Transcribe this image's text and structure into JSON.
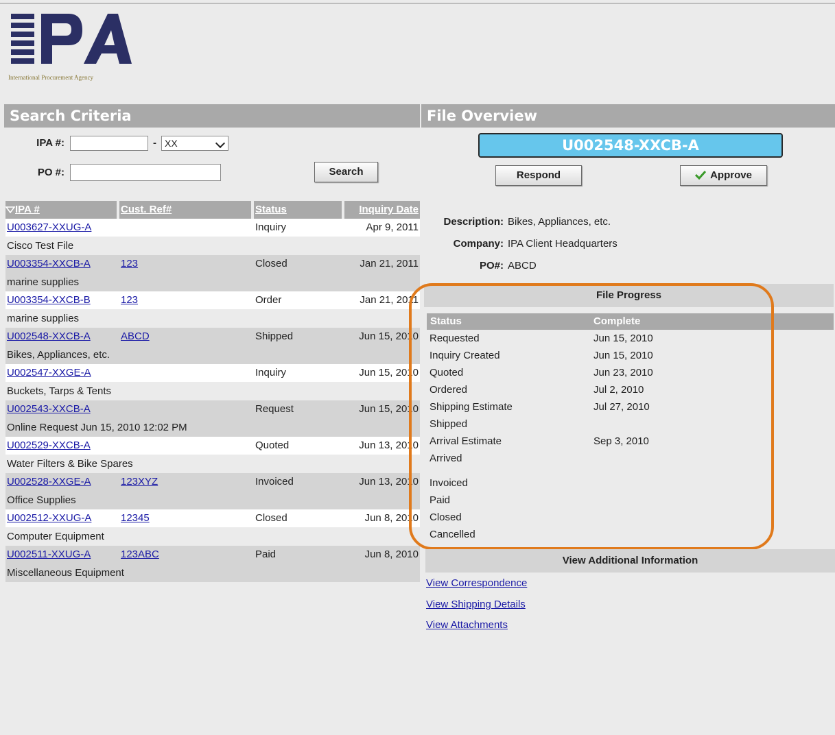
{
  "logo": {
    "letters": "IPA",
    "tagline": "International Procurement Agency"
  },
  "search": {
    "header": "Search Criteria",
    "ipa_label": "IPA #:",
    "ipa_value": "",
    "dash": "-",
    "suffix_select": "XX",
    "po_label": "PO #:",
    "po_value": "",
    "search_button": "Search"
  },
  "results": {
    "columns": [
      "IPA #",
      "Cust. Ref#",
      "Status",
      "Inquiry Date"
    ],
    "sort_icon": "sort-down-triangle-icon",
    "rows": [
      {
        "ipa": "U003627-XXUG-A",
        "ref": "",
        "status": "Inquiry",
        "date": "Apr 9, 2011",
        "desc": "Cisco Test File"
      },
      {
        "ipa": "U003354-XXCB-A",
        "ref": "123",
        "status": "Closed",
        "date": "Jan 21, 2011",
        "desc": "marine supplies"
      },
      {
        "ipa": "U003354-XXCB-B",
        "ref": "123",
        "status": "Order",
        "date": "Jan 21, 2011",
        "desc": "marine supplies"
      },
      {
        "ipa": "U002548-XXCB-A",
        "ref": "ABCD",
        "status": "Shipped",
        "date": "Jun 15, 2010",
        "desc": "Bikes, Appliances, etc."
      },
      {
        "ipa": "U002547-XXGE-A",
        "ref": "",
        "status": "Inquiry",
        "date": "Jun 15, 2010",
        "desc": "Buckets, Tarps & Tents"
      },
      {
        "ipa": "U002543-XXCB-A",
        "ref": "",
        "status": "Request",
        "date": "Jun 15, 2010",
        "desc": "Online Request Jun 15, 2010 12:02 PM"
      },
      {
        "ipa": "U002529-XXCB-A",
        "ref": "",
        "status": "Quoted",
        "date": "Jun 13, 2010",
        "desc": "Water Filters & Bike Spares"
      },
      {
        "ipa": "U002528-XXGE-A",
        "ref": "123XYZ",
        "status": "Invoiced",
        "date": "Jun 13, 2010",
        "desc": "Office Supplies"
      },
      {
        "ipa": "U002512-XXUG-A",
        "ref": "12345",
        "status": "Closed",
        "date": "Jun 8, 2010",
        "desc": "Computer Equipment"
      },
      {
        "ipa": "U002511-XXUG-A",
        "ref": "123ABC",
        "status": "Paid",
        "date": "Jun 8, 2010",
        "desc": "Miscellaneous Equipment"
      }
    ]
  },
  "overview": {
    "header": "File Overview",
    "file_id": "U002548-XXCB-A",
    "respond_button": "Respond",
    "approve_button": "Approve",
    "description_label": "Description:",
    "description": "Bikes, Appliances, etc.",
    "company_label": "Company:",
    "company": "IPA Client Headquarters",
    "po_label": "PO#:",
    "po": "ABCD"
  },
  "progress": {
    "header": "File Progress",
    "status_col": "Status",
    "complete_col": "Complete",
    "steps": [
      {
        "status": "Requested",
        "date": "Jun 15, 2010"
      },
      {
        "status": "Inquiry Created",
        "date": "Jun 15, 2010"
      },
      {
        "status": "Quoted",
        "date": "Jun 23, 2010"
      },
      {
        "status": "Ordered",
        "date": "Jul 2, 2010"
      },
      {
        "status": "Shipping Estimate",
        "date": "Jul 27, 2010"
      },
      {
        "status": "Shipped",
        "date": ""
      },
      {
        "status": "Arrival Estimate",
        "date": "Sep 3, 2010"
      },
      {
        "status": "Arrived",
        "date": ""
      },
      {
        "status": "Invoiced",
        "date": ""
      },
      {
        "status": "Paid",
        "date": ""
      },
      {
        "status": "Closed",
        "date": ""
      },
      {
        "status": "Cancelled",
        "date": ""
      }
    ],
    "highlight_color": "#e07a1c"
  },
  "additional": {
    "header": "View Additional Information",
    "links": [
      "View Correspondence",
      "View Shipping Details",
      "View Attachments"
    ]
  },
  "colors": {
    "header_bg": "#a9a9a9",
    "row_alt_bg": "#d4d4d4",
    "file_id_bg": "#66c6ec",
    "link": "#1a1aa6",
    "logo_navy": "#2b2f64",
    "check_green": "#3a9a2a"
  }
}
